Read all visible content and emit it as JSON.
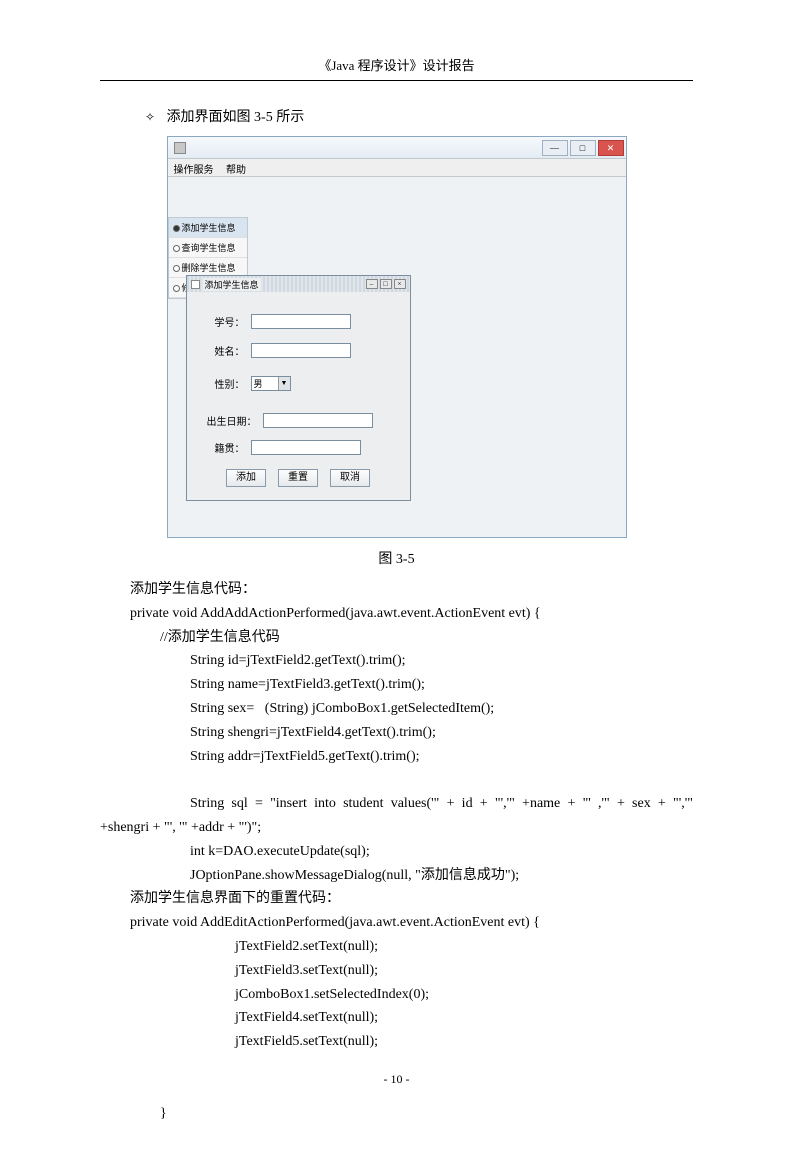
{
  "header": "《Java 程序设计》设计报告",
  "section_title": "添加界面如图 3-5 所示",
  "window": {
    "menubar": {
      "item1": "操作服务",
      "item2": "帮助"
    },
    "sidebar": {
      "item1": "添加学生信息",
      "item2": "查询学生信息",
      "item3": "删除学生信息",
      "item4": "修改学生信息"
    },
    "internal": {
      "title": "添加学生信息",
      "labels": {
        "id": "学号：",
        "name": "姓名：",
        "sex": "性别：",
        "birth": "出生日期：",
        "addr": "籍贯："
      },
      "sex_value": "男",
      "buttons": {
        "add": "添加",
        "reset": "重置",
        "cancel": "取消"
      }
    }
  },
  "caption": "图 3-5",
  "body": {
    "t1": "添加学生信息代码：",
    "t2": "private void AddAddActionPerformed(java.awt.event.ActionEvent evt) {",
    "t3": "//添加学生信息代码",
    "t4": "String id=jTextField2.getText().trim();",
    "t5": "String name=jTextField3.getText().trim();",
    "t6": "String sex=   (String) jComboBox1.getSelectedItem();",
    "t7": "String shengri=jTextField4.getText().trim();",
    "t8": "String addr=jTextField5.getText().trim();",
    "t9a": "String  sql  =  \"insert  into  student  values('\"  +  id  +  \"','\"  +name  +  \"'  ,'\"  +  sex  +  \"','\"",
    "t9b": "+shengri + \"', '\" +addr + \"')\";",
    "t10": "int k=DAO.executeUpdate(sql);",
    "t11": "JOptionPane.showMessageDialog(null, \"添加信息成功\");",
    "t12": "添加学生信息界面下的重置代码：",
    "t13": "private void AddEditActionPerformed(java.awt.event.ActionEvent evt) {",
    "t14": "jTextField2.setText(null);",
    "t15": "jTextField3.setText(null);",
    "t16": "jComboBox1.setSelectedIndex(0);",
    "t17": "jTextField4.setText(null);",
    "t18": "jTextField5.setText(null);",
    "t19": "}"
  },
  "page_no": "- 10 -"
}
